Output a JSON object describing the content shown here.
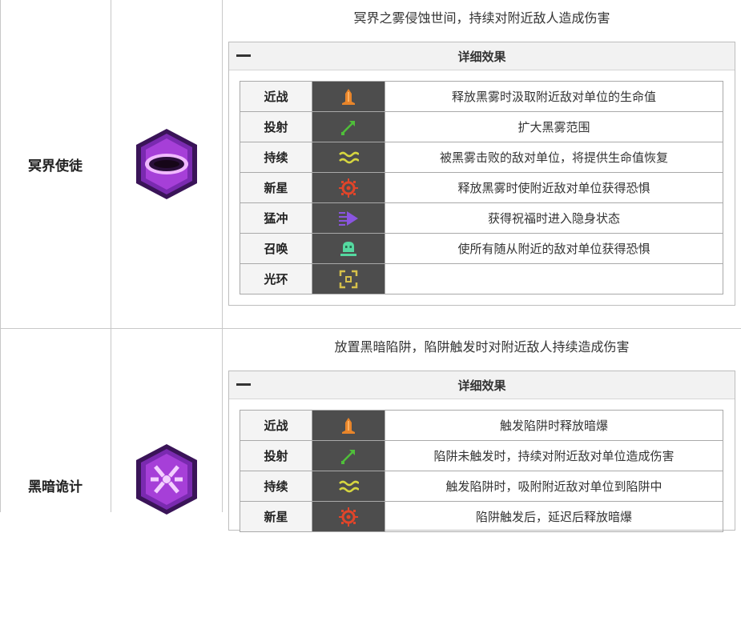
{
  "sections": [
    {
      "name": "冥界使徒",
      "description": "冥界之雾侵蚀世间，持续对附近敌人造成伤害",
      "detail_title": "详细效果",
      "effects": [
        {
          "label": "近战",
          "icon": "melee-icon",
          "text": "释放黑雾时汲取附近敌对单位的生命值"
        },
        {
          "label": "投射",
          "icon": "projectile-icon",
          "text": "扩大黑雾范围"
        },
        {
          "label": "持续",
          "icon": "duration-icon",
          "text": "被黑雾击败的敌对单位，将提供生命值恢复"
        },
        {
          "label": "新星",
          "icon": "nova-icon",
          "text": "释放黑雾时使附近敌对单位获得恐惧"
        },
        {
          "label": "猛冲",
          "icon": "dash-icon",
          "text": "获得祝福时进入隐身状态"
        },
        {
          "label": "召唤",
          "icon": "summon-icon",
          "text": "使所有随从附近的敌对单位获得恐惧"
        },
        {
          "label": "光环",
          "icon": "aura-icon",
          "text": ""
        }
      ]
    },
    {
      "name": "黑暗诡计",
      "description": "放置黑暗陷阱，陷阱触发时对附近敌人持续造成伤害",
      "detail_title": "详细效果",
      "effects": [
        {
          "label": "近战",
          "icon": "melee-icon",
          "text": "触发陷阱时释放暗爆"
        },
        {
          "label": "投射",
          "icon": "projectile-icon",
          "text": "陷阱未触发时，持续对附近敌对单位造成伤害"
        },
        {
          "label": "持续",
          "icon": "duration-icon",
          "text": "触发陷阱时，吸附附近敌对单位到陷阱中"
        },
        {
          "label": "新星",
          "icon": "nova-icon",
          "text": "陷阱触发后，延迟后释放暗爆"
        }
      ]
    }
  ],
  "colors": {
    "melee": "#e8852a",
    "projectile": "#4fbf3a",
    "duration": "#d6d640",
    "nova": "#e0452a",
    "dash": "#8a55e0",
    "summon": "#55d9a0",
    "aura": "#d6c04a"
  }
}
